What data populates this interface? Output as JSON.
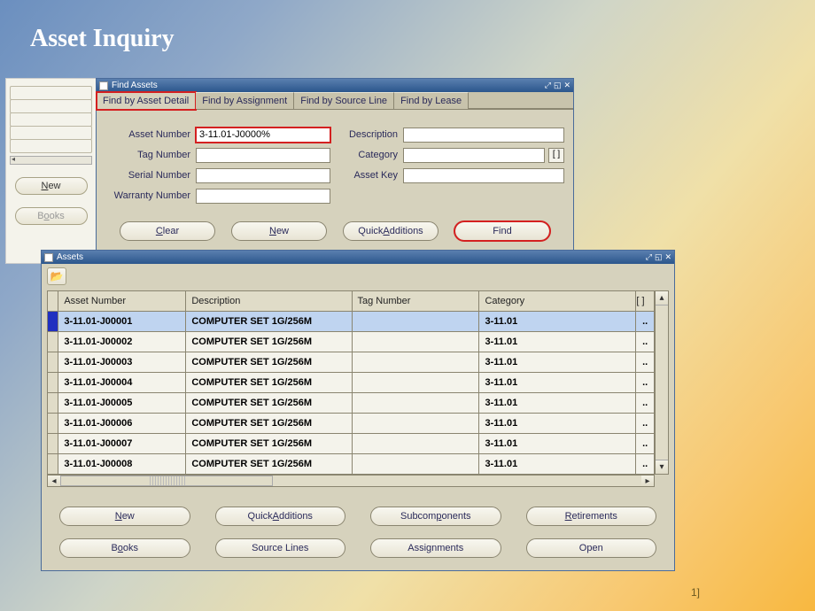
{
  "page": {
    "title": "Asset Inquiry",
    "slide_num": "1]"
  },
  "leftPanel": {
    "new_label": "New",
    "books_label": "Books"
  },
  "findWindow": {
    "title": "Find Assets",
    "tabs": [
      "Find by Asset Detail",
      "Find by Assignment",
      "Find by Source Line",
      "Find by Lease"
    ],
    "active_tab": 0,
    "fields": {
      "asset_number_label": "Asset Number",
      "asset_number_value": "3-11.01-J0000%",
      "tag_number_label": "Tag Number",
      "tag_number_value": "",
      "serial_number_label": "Serial Number",
      "serial_number_value": "",
      "warranty_number_label": "Warranty Number",
      "warranty_number_value": "",
      "description_label": "Description",
      "description_value": "",
      "category_label": "Category",
      "category_value": "",
      "asset_key_label": "Asset Key",
      "asset_key_value": ""
    },
    "buttons": {
      "clear": "Clear",
      "new": "New",
      "quickadd": "QuickAdditions",
      "find": "Find"
    }
  },
  "assetsWindow": {
    "title": "Assets",
    "columns": [
      "Asset Number",
      "Description",
      "Tag Number",
      "Category",
      "[ ]"
    ],
    "rows": [
      {
        "asset_number": "3-11.01-J00001",
        "description": "COMPUTER SET 1G/256M",
        "tag": "",
        "category": "3-11.01"
      },
      {
        "asset_number": "3-11.01-J00002",
        "description": "COMPUTER SET 1G/256M",
        "tag": "",
        "category": "3-11.01"
      },
      {
        "asset_number": "3-11.01-J00003",
        "description": "COMPUTER SET 1G/256M",
        "tag": "",
        "category": "3-11.01"
      },
      {
        "asset_number": "3-11.01-J00004",
        "description": "COMPUTER SET 1G/256M",
        "tag": "",
        "category": "3-11.01"
      },
      {
        "asset_number": "3-11.01-J00005",
        "description": "COMPUTER SET 1G/256M",
        "tag": "",
        "category": "3-11.01"
      },
      {
        "asset_number": "3-11.01-J00006",
        "description": "COMPUTER SET 1G/256M",
        "tag": "",
        "category": "3-11.01"
      },
      {
        "asset_number": "3-11.01-J00007",
        "description": "COMPUTER SET 1G/256M",
        "tag": "",
        "category": "3-11.01"
      },
      {
        "asset_number": "3-11.01-J00008",
        "description": "COMPUTER SET 1G/256M",
        "tag": "",
        "category": "3-11.01"
      }
    ],
    "selected_row": 0,
    "buttons": {
      "new": "New",
      "quickadd": "QuickAdditions",
      "subcomponents": "Subcomponents",
      "retirements": "Retirements",
      "books": "Books",
      "source_lines": "Source Lines",
      "assignments": "Assignments",
      "open": "Open"
    }
  }
}
